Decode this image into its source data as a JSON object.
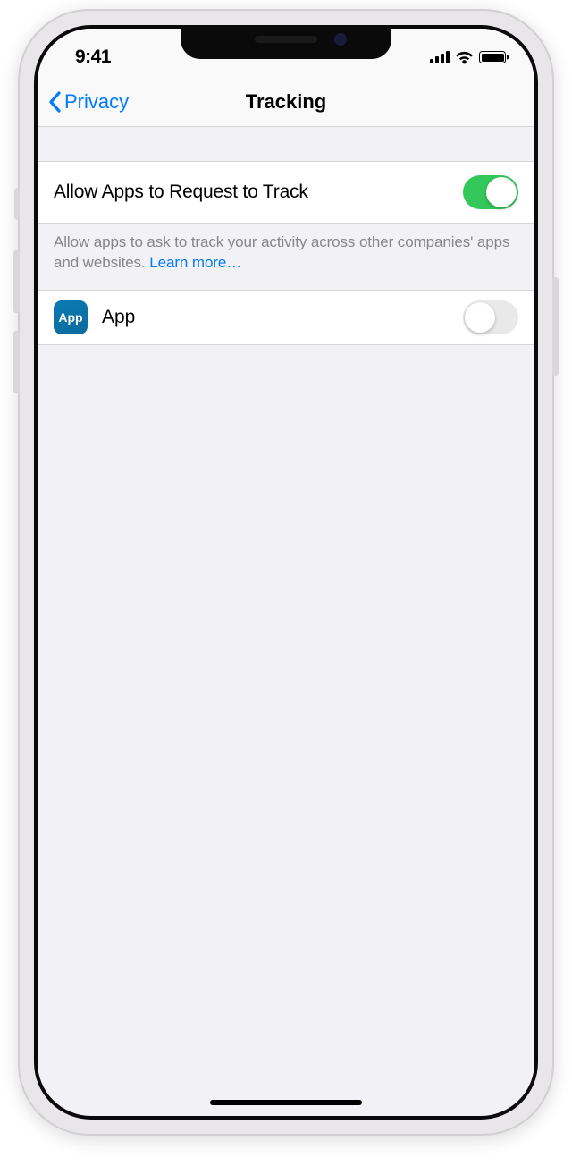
{
  "status": {
    "time": "9:41"
  },
  "nav": {
    "back_label": "Privacy",
    "title": "Tracking"
  },
  "settings": {
    "allow_request": {
      "label": "Allow Apps to Request to Track",
      "enabled": true
    },
    "footer": {
      "text": "Allow apps to ask to track your activity across other companies' apps and websites. ",
      "link": "Learn more…"
    },
    "apps": [
      {
        "icon_label": "App",
        "name": "App",
        "enabled": false
      }
    ]
  }
}
